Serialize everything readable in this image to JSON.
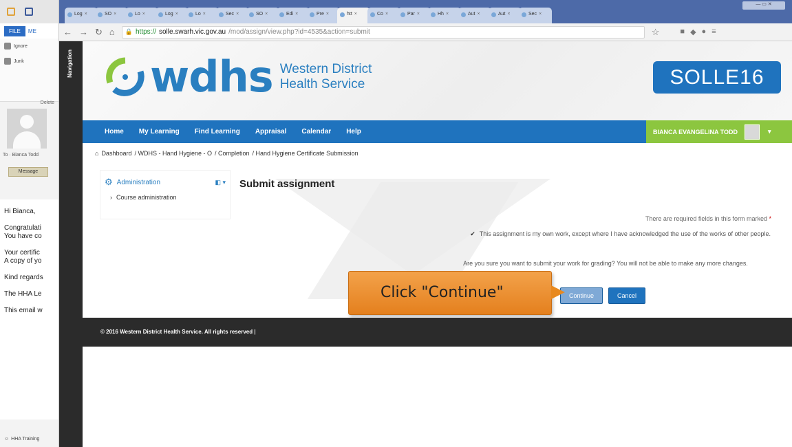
{
  "outlook": {
    "file_tab": "FILE",
    "msg_tab": "ME",
    "ignore_label": "Ignore",
    "junk_label": "Junk",
    "delete_label": "Delete",
    "to_line": "To · Bianca Todd",
    "message_button": "Message",
    "email_lines": [
      "Hi Bianca,",
      "Congratulati",
      "You have co",
      "Your certific",
      "A copy of yo",
      "Kind regards",
      "The HHA Le",
      "This email w"
    ],
    "footer_label": "HHA Training"
  },
  "browser": {
    "tabs": [
      "Log",
      "SO",
      "Lo",
      "Log",
      "Lo",
      "Sec",
      "SO",
      "Edi",
      "Pre",
      "htt",
      "Co",
      "Par",
      "Hh",
      "Aut",
      "Aut",
      "Sec"
    ],
    "active_tab_index": 9,
    "url_scheme": "https://",
    "url_host": "solle.swarh.vic.gov.au",
    "url_path": "/mod/assign/view.php?id=4535&action=submit"
  },
  "site": {
    "nav_drawer_label": "Navigation",
    "logo_text": "wdhs",
    "logo_sub_1": "Western District",
    "logo_sub_2": "Health Service",
    "badge": "SOLLE16",
    "menu": [
      "Home",
      "My Learning",
      "Find Learning",
      "Appraisal",
      "Calendar",
      "Help"
    ],
    "user_name": "BIANCA EVANGELINA TODD",
    "breadcrumb": [
      "Dashboard",
      "/ WDHS - Hand Hygiene - O",
      "/ Completion",
      "/ Hand Hygiene Certificate Submission"
    ],
    "admin_block": {
      "title": "Administration",
      "item": "Course administration"
    },
    "page_title": "Submit assignment",
    "required_note": "There are required fields in this form marked",
    "statement": "This assignment is my own work, except where I have acknowledged the use of the works of other people.",
    "confirm_text": "Are you sure you want to submit your work for grading? You will not be able to make any more changes.",
    "continue_label": "Continue",
    "cancel_label": "Cancel",
    "footer_text": "© 2016 Western District Health Service. All rights reserved |",
    "callout": "Click \"Continue\""
  },
  "colors": {
    "brand_blue": "#1f73be",
    "user_green": "#8cc63f",
    "callout_orange": "#e8891f"
  }
}
